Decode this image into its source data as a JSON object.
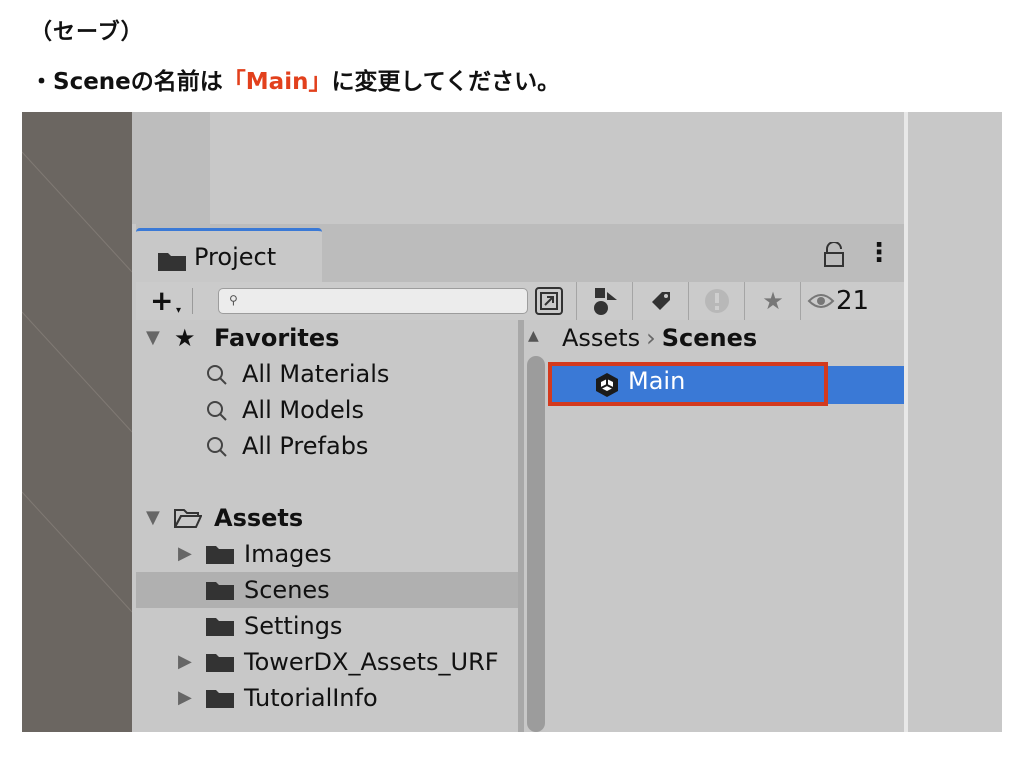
{
  "doc": {
    "title": "（セーブ）",
    "instruction_prefix": "・Sceneの名前は",
    "instruction_highlight": "「Main」",
    "instruction_suffix": "に変更してください。"
  },
  "project_window": {
    "tab_label": "Project",
    "search": {
      "value": "",
      "placeholder": ""
    },
    "hidden_count": "21",
    "tree": [
      {
        "label": "Favorites",
        "type": "section",
        "icon": "star-icon"
      },
      {
        "label": "All Materials",
        "type": "search"
      },
      {
        "label": "All Models",
        "type": "search"
      },
      {
        "label": "All Prefabs",
        "type": "search"
      },
      {
        "label": "Assets",
        "type": "section",
        "icon": "folder-open-icon"
      },
      {
        "label": "Images",
        "type": "folder",
        "expandable": true
      },
      {
        "label": "Scenes",
        "type": "folder",
        "selected": true
      },
      {
        "label": "Settings",
        "type": "folder"
      },
      {
        "label": "TowerDX_Assets_URF",
        "type": "folder",
        "expandable": true
      },
      {
        "label": "TutorialInfo",
        "type": "folder",
        "expandable": true
      }
    ],
    "breadcrumb": {
      "root": "Assets",
      "current": "Scenes"
    },
    "selected_asset": {
      "name": "Main",
      "icon": "unity-scene-icon"
    },
    "colors": {
      "selection": "#3a79d6",
      "highlight_box": "#d33a1e",
      "instruction_highlight": "#e2401c"
    }
  }
}
